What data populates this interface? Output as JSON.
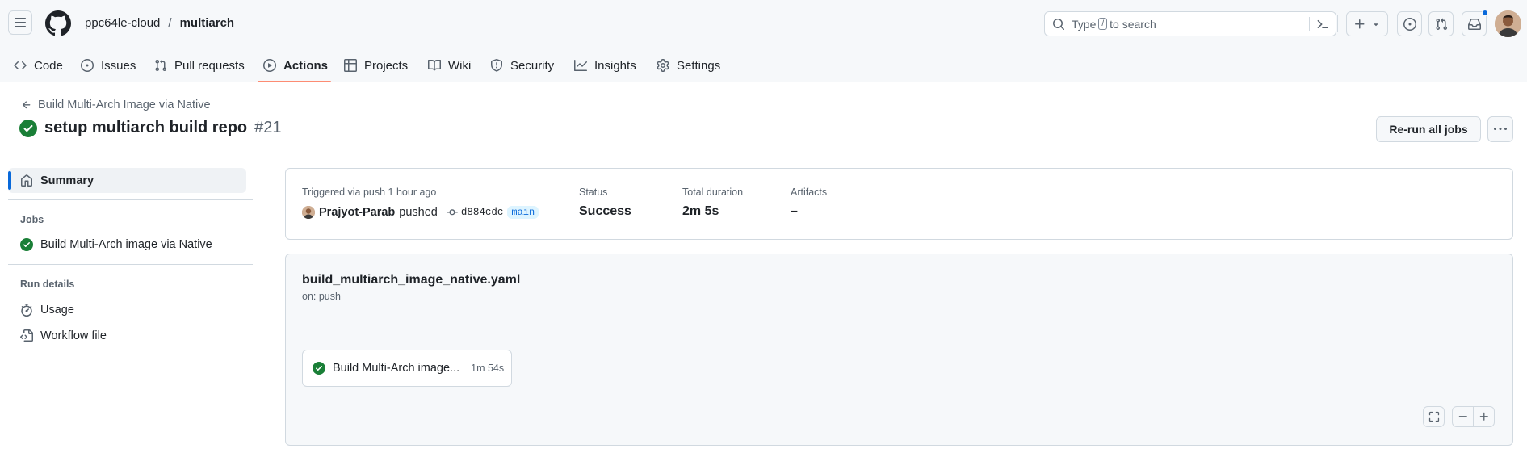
{
  "header": {
    "owner": "ppc64le-cloud",
    "separator": "/",
    "repo": "multiarch",
    "search_placeholder_prefix": "Type",
    "search_key": "/",
    "search_placeholder_suffix": "to search"
  },
  "tabs": [
    {
      "label": "Code",
      "icon": "code-icon"
    },
    {
      "label": "Issues",
      "icon": "issue-opened-icon"
    },
    {
      "label": "Pull requests",
      "icon": "git-pull-request-icon"
    },
    {
      "label": "Actions",
      "icon": "play-icon",
      "active": true
    },
    {
      "label": "Projects",
      "icon": "table-icon"
    },
    {
      "label": "Wiki",
      "icon": "book-icon"
    },
    {
      "label": "Security",
      "icon": "shield-icon"
    },
    {
      "label": "Insights",
      "icon": "graph-icon"
    },
    {
      "label": "Settings",
      "icon": "gear-icon"
    }
  ],
  "run": {
    "back_label": "Build Multi-Arch Image via Native",
    "title": "setup multiarch build repo",
    "number": "#21",
    "rerun_label": "Re-run all jobs"
  },
  "sidebar": {
    "summary_label": "Summary",
    "jobs_heading": "Jobs",
    "job_label": "Build Multi-Arch image via Native",
    "run_details_heading": "Run details",
    "usage_label": "Usage",
    "workflow_file_label": "Workflow file"
  },
  "summary": {
    "trigger_text": "Triggered via push 1 hour ago",
    "actor": "Prajyot-Parab",
    "action": "pushed",
    "commit": "d884cdc",
    "branch": "main",
    "status_label": "Status",
    "status_value": "Success",
    "duration_label": "Total duration",
    "duration_value": "2m 5s",
    "artifacts_label": "Artifacts",
    "artifacts_value": "–"
  },
  "workflow": {
    "file": "build_multiarch_image_native.yaml",
    "trigger": "on: push",
    "job_name": "Build Multi-Arch image...",
    "job_duration": "1m 54s"
  },
  "colors": {
    "success": "#1a7f37",
    "accent": "#0969da",
    "tab_underline": "#fd8c73"
  }
}
